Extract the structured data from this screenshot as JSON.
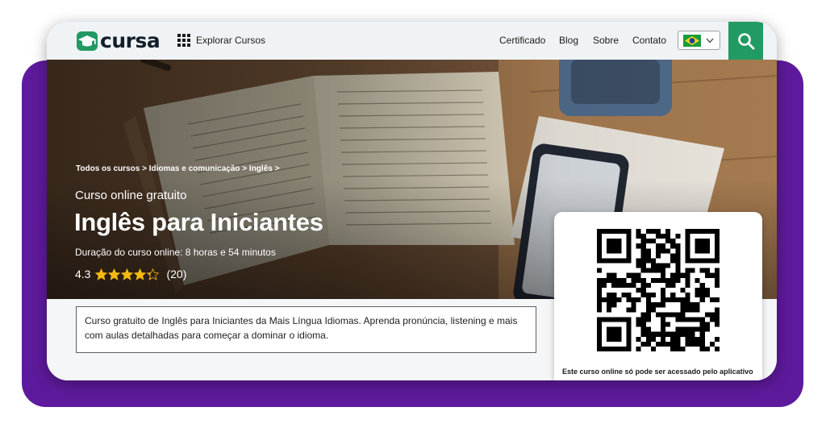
{
  "header": {
    "logo_text": "cursa",
    "explore_label": "Explorar Cursos",
    "nav": [
      "Certificado",
      "Blog",
      "Sobre",
      "Contato"
    ],
    "language": "pt-BR",
    "icons": [
      "graduation-cap-logo-icon",
      "grid-icon",
      "brazil-flag-icon",
      "chevron-down-icon",
      "search-icon"
    ]
  },
  "hero": {
    "breadcrumb": [
      "Todos os cursos",
      "Idiomas e comunicação",
      "Inglês"
    ],
    "breadcrumb_separator": ">",
    "subtitle": "Curso online gratuito",
    "title": "Inglês para Iniciantes",
    "duration": "Duração do curso online: 8 horas e 54 minutos",
    "rating_value": "4.3",
    "rating_stars": 4.3,
    "rating_count": "(20)"
  },
  "description": "Curso gratuito de Inglês para Iniciantes da Mais Língua Idiomas. Aprenda pronúncia, listening e mais com aulas detalhadas para começar a dominar o idioma.",
  "qr_card": {
    "caption": "Este curso online só pode ser acessado pelo aplicativo"
  },
  "colors": {
    "brand_green": "#219a63",
    "frame_purple": "#5e1a9c",
    "star_yellow": "#f5b90f",
    "header_bg": "#f0f3f5"
  }
}
